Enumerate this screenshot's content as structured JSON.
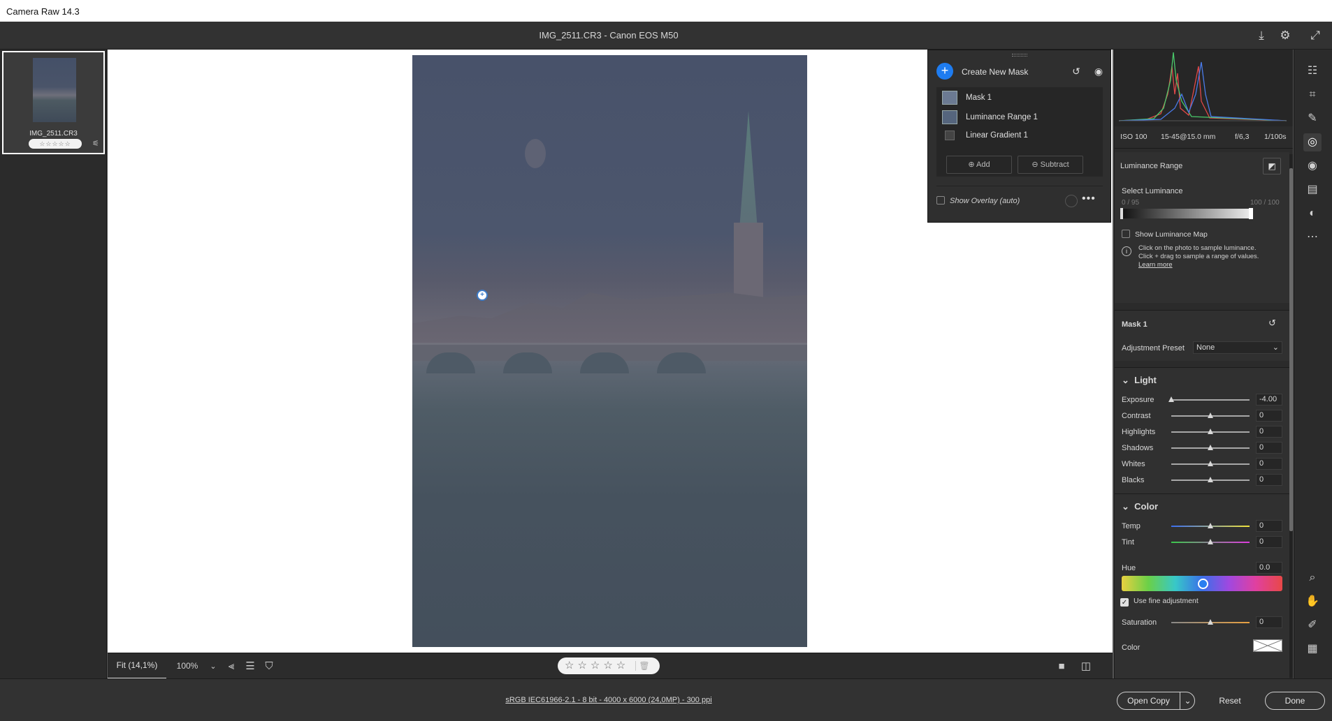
{
  "window": {
    "title": "Camera Raw 14.3"
  },
  "header": {
    "doc_title": "IMG_2511.CR3  -  Canon EOS M50",
    "icons": [
      "save-icon",
      "settings-gear-icon",
      "fullscreen-icon"
    ]
  },
  "filmstrip": {
    "thumbnail": {
      "name": "IMG_2511.CR3",
      "stars": "☆☆☆☆☆",
      "edited_badge": "⚟"
    }
  },
  "mask_panel": {
    "create_label": "Create New Mask",
    "masks": [
      {
        "label": "Mask 1"
      },
      {
        "label": "Luminance Range 1"
      },
      {
        "label": "Linear Gradient 1"
      }
    ],
    "add_label": "Add",
    "subtract_label": "Subtract",
    "overlay_label": "Show Overlay (auto)",
    "more": "•••"
  },
  "canvas_toolbar": {
    "zoom_fit": "Fit (14,1%)",
    "zoom_100": "100%",
    "rating": "☆☆☆☆☆",
    "trash": "🗑"
  },
  "status": {
    "workflow_link": "sRGB IEC61966-2.1 - 8 bit - 4000 x 6000 (24,0MP) - 300 ppi",
    "open_copy": "Open Copy",
    "caret": "⌄",
    "reset": "Reset",
    "done": "Done"
  },
  "histogram": {
    "iso": "ISO 100",
    "lens": "15-45@15.0 mm",
    "aperture": "f/6,3",
    "shutter": "1/100s"
  },
  "luminance": {
    "title": "Luminance Range",
    "select_label": "Select Luminance",
    "range_left": "0 / 95",
    "range_right": "100 / 100",
    "show_map": "Show Luminance Map",
    "info_text": "Click on the photo to sample luminance. Click + drag to sample a range of values.",
    "learn_more": "Learn more"
  },
  "mask_settings": {
    "title": "Mask 1",
    "preset_label": "Adjustment Preset",
    "preset_value": "None"
  },
  "light": {
    "title": "Light",
    "sliders": [
      {
        "label": "Exposure",
        "value": "-4.00",
        "position": 0.0
      },
      {
        "label": "Contrast",
        "value": "0",
        "position": 0.5
      },
      {
        "label": "Highlights",
        "value": "0",
        "position": 0.5
      },
      {
        "label": "Shadows",
        "value": "0",
        "position": 0.5
      },
      {
        "label": "Whites",
        "value": "0",
        "position": 0.5
      },
      {
        "label": "Blacks",
        "value": "0",
        "position": 0.5
      }
    ]
  },
  "color": {
    "title": "Color",
    "temp": {
      "label": "Temp",
      "value": "0"
    },
    "tint": {
      "label": "Tint",
      "value": "0"
    },
    "hue": {
      "label": "Hue",
      "value": "0.0"
    },
    "fine_adjust": "Use fine adjustment",
    "saturation": {
      "label": "Saturation",
      "value": "0"
    },
    "color_label": "Color"
  },
  "colors": {
    "accent": "#1e7cf0",
    "panel": "#2b2b2b",
    "canvas": "#ffffff"
  }
}
